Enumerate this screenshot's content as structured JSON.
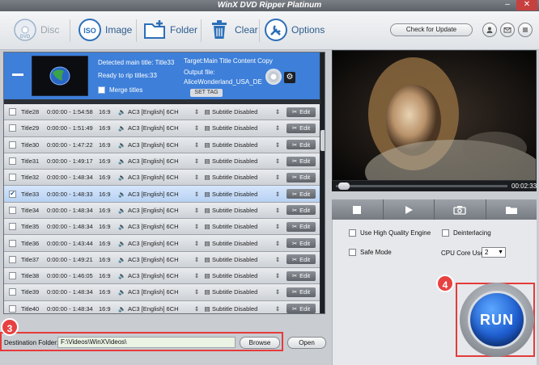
{
  "window": {
    "title": "WinX DVD Ripper Platinum"
  },
  "toolbar": {
    "disc_label": "Disc",
    "image_label": "Image",
    "folder_label": "Folder",
    "clear_label": "Clear",
    "options_label": "Options",
    "update_label": "Check for Update"
  },
  "header": {
    "detected": "Detected main title: Title33",
    "ready": "Ready to rip titles:33",
    "merge": "Merge titles",
    "target": "Target:Main Title Content Copy",
    "output_label": "Output file:",
    "output_file": "AliceWonderland_USA_DE",
    "set_tag": "SET TAG"
  },
  "titles": [
    {
      "name": "Title28",
      "duration": "0:00:00 - 1:54:58",
      "ratio": "16:9",
      "audio": "AC3 [English] 6CH",
      "subtitle": "Subtitle Disabled",
      "edit": "Edit",
      "checked": false,
      "selected": false
    },
    {
      "name": "Title29",
      "duration": "0:00:00 - 1:51:49",
      "ratio": "16:9",
      "audio": "AC3 [English] 6CH",
      "subtitle": "Subtitle Disabled",
      "edit": "Edit",
      "checked": false,
      "selected": false
    },
    {
      "name": "Title30",
      "duration": "0:00:00 - 1:47:22",
      "ratio": "16:9",
      "audio": "AC3 [English] 6CH",
      "subtitle": "Subtitle Disabled",
      "edit": "Edit",
      "checked": false,
      "selected": false
    },
    {
      "name": "Title31",
      "duration": "0:00:00 - 1:49:17",
      "ratio": "16:9",
      "audio": "AC3 [English] 6CH",
      "subtitle": "Subtitle Disabled",
      "edit": "Edit",
      "checked": false,
      "selected": false
    },
    {
      "name": "Title32",
      "duration": "0:00:00 - 1:48:34",
      "ratio": "16:9",
      "audio": "AC3 [English] 6CH",
      "subtitle": "Subtitle Disabled",
      "edit": "Edit",
      "checked": false,
      "selected": false
    },
    {
      "name": "Title33",
      "duration": "0:00:00 - 1:48:33",
      "ratio": "16:9",
      "audio": "AC3 [English] 6CH",
      "subtitle": "Subtitle Disabled",
      "edit": "Edit",
      "checked": true,
      "selected": true
    },
    {
      "name": "Title34",
      "duration": "0:00:00 - 1:48:34",
      "ratio": "16:9",
      "audio": "AC3 [English] 6CH",
      "subtitle": "Subtitle Disabled",
      "edit": "Edit",
      "checked": false,
      "selected": false
    },
    {
      "name": "Title35",
      "duration": "0:00:00 - 1:48:34",
      "ratio": "16:9",
      "audio": "AC3 [English] 6CH",
      "subtitle": "Subtitle Disabled",
      "edit": "Edit",
      "checked": false,
      "selected": false
    },
    {
      "name": "Title36",
      "duration": "0:00:00 - 1:43:44",
      "ratio": "16:9",
      "audio": "AC3 [English] 6CH",
      "subtitle": "Subtitle Disabled",
      "edit": "Edit",
      "checked": false,
      "selected": false
    },
    {
      "name": "Title37",
      "duration": "0:00:00 - 1:49:21",
      "ratio": "16:9",
      "audio": "AC3 [English] 6CH",
      "subtitle": "Subtitle Disabled",
      "edit": "Edit",
      "checked": false,
      "selected": false
    },
    {
      "name": "Title38",
      "duration": "0:00:00 - 1:46:05",
      "ratio": "16:9",
      "audio": "AC3 [English] 6CH",
      "subtitle": "Subtitle Disabled",
      "edit": "Edit",
      "checked": false,
      "selected": false
    },
    {
      "name": "Title39",
      "duration": "0:00:00 - 1:48:34",
      "ratio": "16:9",
      "audio": "AC3 [English] 6CH",
      "subtitle": "Subtitle Disabled",
      "edit": "Edit",
      "checked": false,
      "selected": false
    },
    {
      "name": "Title40",
      "duration": "0:00:00 - 1:48:34",
      "ratio": "16:9",
      "audio": "AC3 [English] 6CH",
      "subtitle": "Subtitle Disabled",
      "edit": "Edit",
      "checked": false,
      "selected": false
    }
  ],
  "destination": {
    "label": "Destination Folder:",
    "value": "F:\\Videos\\WinXVideos\\",
    "browse": "Browse",
    "open": "Open"
  },
  "preview": {
    "time": "00:02:33",
    "progress": 0.03
  },
  "options": {
    "hq_engine": "Use High Quality Engine",
    "deinterlacing": "Deinterlacing",
    "safe_mode": "Safe Mode",
    "cpu_label": "CPU Core Use:",
    "cpu_value": "2"
  },
  "run_label": "RUN",
  "badges": {
    "b3": "3",
    "b4": "4"
  },
  "colors": {
    "accent": "#3d7fd9",
    "highlight": "#e53b3b",
    "run": "#1f5fd1"
  },
  "icons": [
    "disc-icon",
    "iso-image-icon",
    "folder-add-icon",
    "trash-icon",
    "wrench-icon",
    "user-icon",
    "mail-icon",
    "menu-icon",
    "stop-icon",
    "play-icon",
    "camera-icon",
    "folder-open-icon"
  ]
}
